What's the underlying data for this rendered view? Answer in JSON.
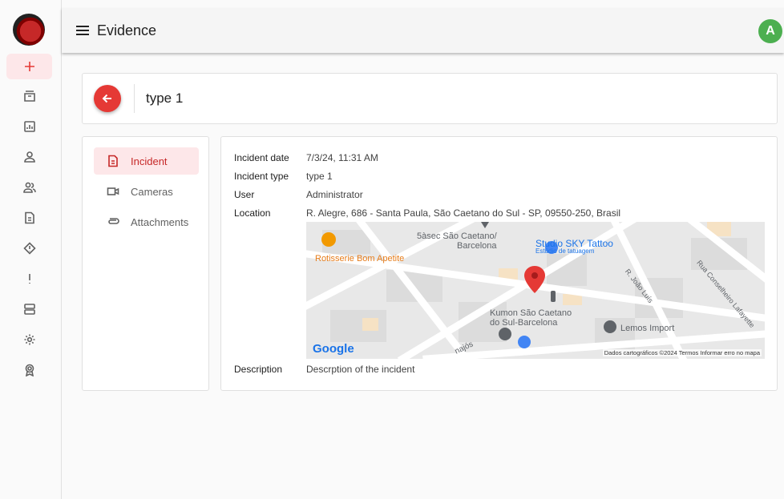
{
  "app": {
    "title": "Evidence",
    "avatar_initial": "A"
  },
  "rail": {
    "items": [
      {
        "name": "add",
        "active": true
      },
      {
        "name": "archive"
      },
      {
        "name": "reports"
      },
      {
        "name": "user"
      },
      {
        "name": "users"
      },
      {
        "name": "document"
      },
      {
        "name": "warning"
      },
      {
        "name": "alert"
      },
      {
        "name": "server"
      },
      {
        "name": "settings"
      },
      {
        "name": "badge"
      }
    ]
  },
  "header": {
    "title": "type 1"
  },
  "nav": {
    "items": [
      {
        "label": "Incident",
        "icon": "document-icon",
        "active": true
      },
      {
        "label": "Cameras",
        "icon": "camera-icon"
      },
      {
        "label": "Attachments",
        "icon": "paperclip-icon"
      }
    ]
  },
  "details": {
    "incident_date_label": "Incident date",
    "incident_date": "7/3/24, 11:31 AM",
    "incident_type_label": "Incident type",
    "incident_type": "type 1",
    "user_label": "User",
    "user": "Administrator",
    "location_label": "Location",
    "location": "R. Alegre, 686 - Santa Paula, São Caetano do Sul - SP, 09550-250, Brasil",
    "description_label": "Description",
    "description": "Descrption of the incident"
  },
  "map": {
    "places": [
      {
        "name": "5àsec São Caetano/",
        "color": "gray"
      },
      {
        "name": "Barcelona",
        "color": "gray"
      },
      {
        "name": "Studio SKY Tattoo",
        "color": "blue"
      },
      {
        "name": "Estúdio de tatuagem",
        "color": "blue"
      },
      {
        "name": "Rotisserie Bom Apetite",
        "color": "orange"
      },
      {
        "name": "Kumon São Caetano",
        "color": "gray"
      },
      {
        "name": "do Sul-Barcelona",
        "color": "gray"
      },
      {
        "name": "Lemos Import",
        "color": "gray"
      }
    ],
    "streets": [
      "R. João Luís",
      "Rua Conselheiro Lafayette",
      "najós"
    ],
    "logo": "Google",
    "attribution": "Dados cartográficos ©2024   Termos   Informar erro no mapa"
  }
}
